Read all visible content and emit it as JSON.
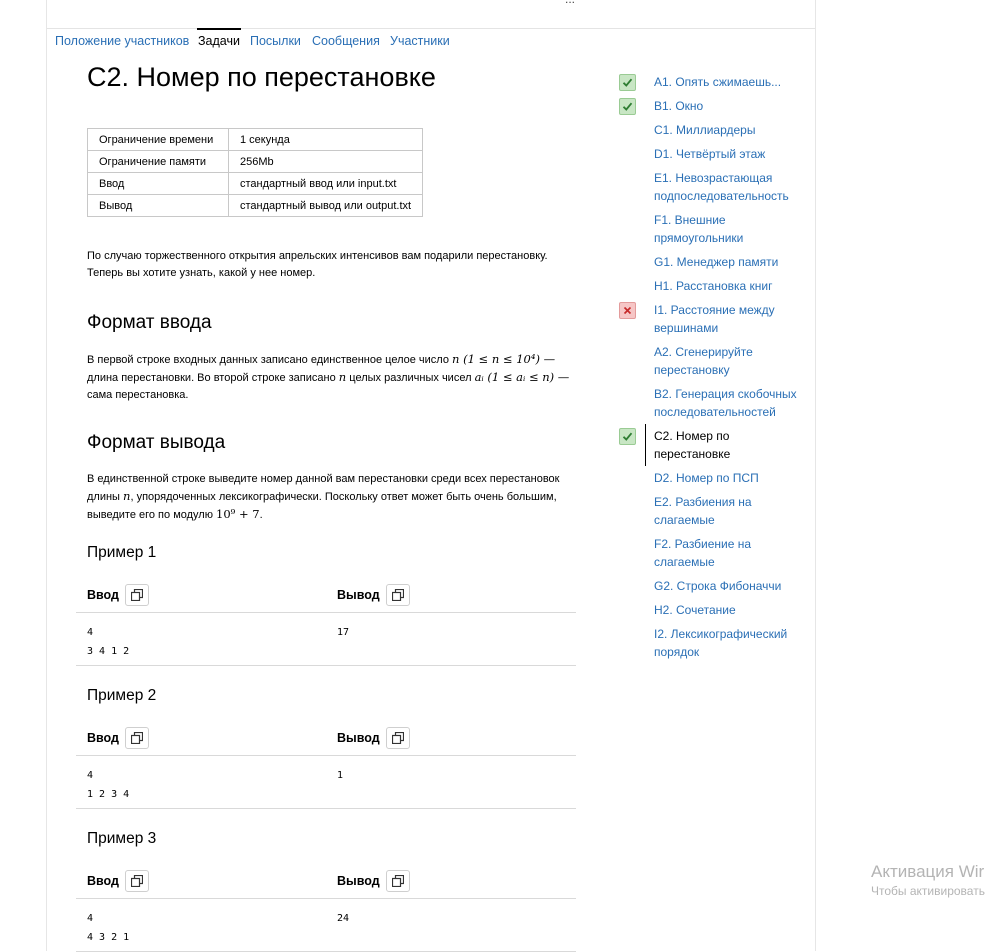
{
  "top": {
    "ellipsis": "..."
  },
  "nav": {
    "tabs": [
      {
        "label": "Положение участников",
        "active": false
      },
      {
        "label": "Задачи",
        "active": true
      },
      {
        "label": "Посылки",
        "active": false
      },
      {
        "label": "Сообщения",
        "active": false
      },
      {
        "label": "Участники",
        "active": false
      }
    ]
  },
  "problem": {
    "title": "C2. Номер по перестановке",
    "limits": [
      {
        "key": "Ограничение времени",
        "value": "1 секунда"
      },
      {
        "key": "Ограничение памяти",
        "value": "256Mb"
      },
      {
        "key": "Ввод",
        "value": "стандартный ввод или input.txt"
      },
      {
        "key": "Вывод",
        "value": "стандартный вывод или output.txt"
      }
    ],
    "statement_line1": "По случаю торжественного открытия апрельских интенсивов вам подарили перестановку.",
    "statement_line2": "Теперь вы хотите узнать, какой у нее номер.",
    "input_heading": "Формат ввода",
    "input": {
      "t1": "В первой строке входных данных записано единственное целое число",
      "f1": "n (1 ≤ n ≤ 10⁴) —",
      "t2": "длина перестановки. Во второй строке записано",
      "f2": "n",
      "t3": "целых различных чисел",
      "f3": "aᵢ (1 ≤ aᵢ ≤ n) —",
      "t4": "сама перестановка."
    },
    "output_heading": "Формат вывода",
    "output": {
      "t1": "В единственной строке выведите номер данной вам перестановки среди всех перестановок",
      "t2a": "длины",
      "f1": "n",
      "t2b": ", упорядоченных лексикографически. Поскольку ответ может быть очень большим,",
      "t3": "выведите его по модулю",
      "f2": "10⁹ + 7",
      "t3b": "."
    },
    "input_label": "Ввод",
    "output_label": "Вывод",
    "examples": [
      {
        "title": "Пример 1",
        "input": "4\n3 4 1 2",
        "output": "17"
      },
      {
        "title": "Пример 2",
        "input": "4\n1 2 3 4",
        "output": "1"
      },
      {
        "title": "Пример 3",
        "input": "4\n4 3 2 1",
        "output": "24"
      }
    ]
  },
  "tasks": [
    {
      "label": "A1. Опять сжимаешь...",
      "status": "ok"
    },
    {
      "label": "B1. Окно",
      "status": "ok"
    },
    {
      "label": "C1. Миллиардеры",
      "status": ""
    },
    {
      "label": "D1. Четвёртый этаж",
      "status": ""
    },
    {
      "label": "E1. Невозрастающая подпоследовательность",
      "status": ""
    },
    {
      "label": "F1. Внешние прямоугольники",
      "status": ""
    },
    {
      "label": "G1. Менеджер памяти",
      "status": ""
    },
    {
      "label": "H1. Расстановка книг",
      "status": ""
    },
    {
      "label": "I1. Расстояние между вершинами",
      "status": "fail"
    },
    {
      "label": "A2. Сгенерируйте перестановку",
      "status": ""
    },
    {
      "label": "B2. Генерация скобочных последовательностей",
      "status": ""
    },
    {
      "label": "C2. Номер по перестановке",
      "status": "ok",
      "current": true
    },
    {
      "label": "D2. Номер по ПСП",
      "status": ""
    },
    {
      "label": "E2. Разбиения на слагаемые",
      "status": ""
    },
    {
      "label": "F2. Разбиение на слагаемые",
      "status": ""
    },
    {
      "label": "G2. Строка Фибоначчи",
      "status": ""
    },
    {
      "label": "H2. Сочетание",
      "status": ""
    },
    {
      "label": "I2. Лексикографический порядок",
      "status": ""
    }
  ],
  "watermark": {
    "line1": "Активация Wir",
    "line2": "Чтобы активировать"
  }
}
